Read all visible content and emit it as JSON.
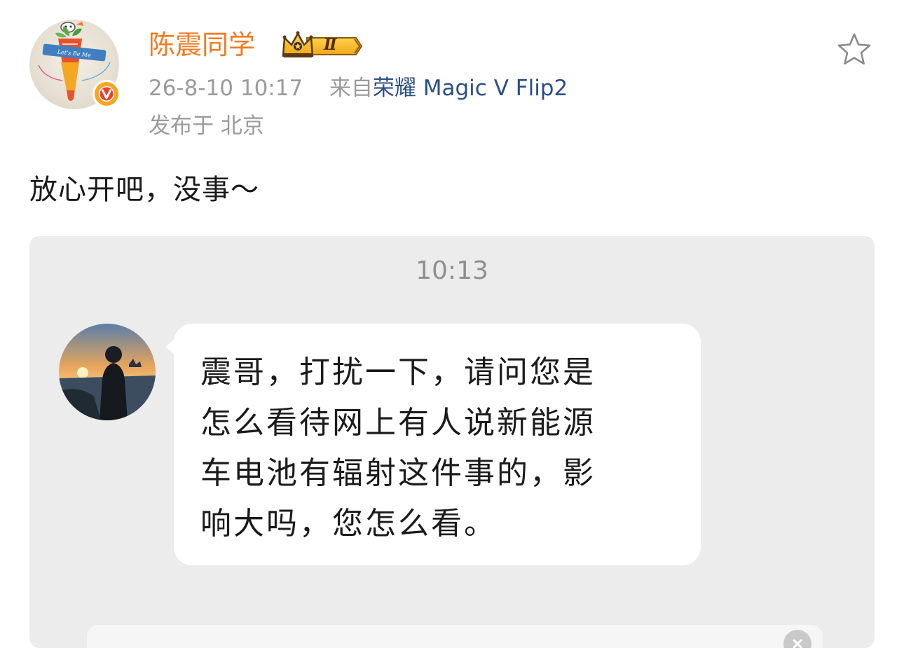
{
  "post": {
    "author": "陈震同学",
    "vip_level": "Ⅱ",
    "timestamp": "26-8-10 10:17",
    "source_prefix": "来自",
    "source_device": "荣耀 Magic V Flip2",
    "location": "发布于 北京",
    "text": "放心开吧，没事～"
  },
  "icons": {
    "avatar": "carrot-avatar",
    "verified": "verified-v-icon",
    "vip": "crown-vip-icon",
    "favorite": "star-outline-icon",
    "clear": "close-circle-icon"
  },
  "colors": {
    "author": "#f47b20",
    "meta": "#9b9b9b",
    "device_link": "#2b4f86",
    "card_bg": "#ececec",
    "verified_badge": "#f5a623"
  },
  "screenshot": {
    "time": "10:13",
    "message_lines": [
      "震哥，打扰一下，请问您是",
      "怎么看待网上有人说新能源",
      "车电池有辐射这件事的，影",
      "响大吗，您怎么看。"
    ],
    "avatar_icon": "sunset-person-avatar"
  }
}
